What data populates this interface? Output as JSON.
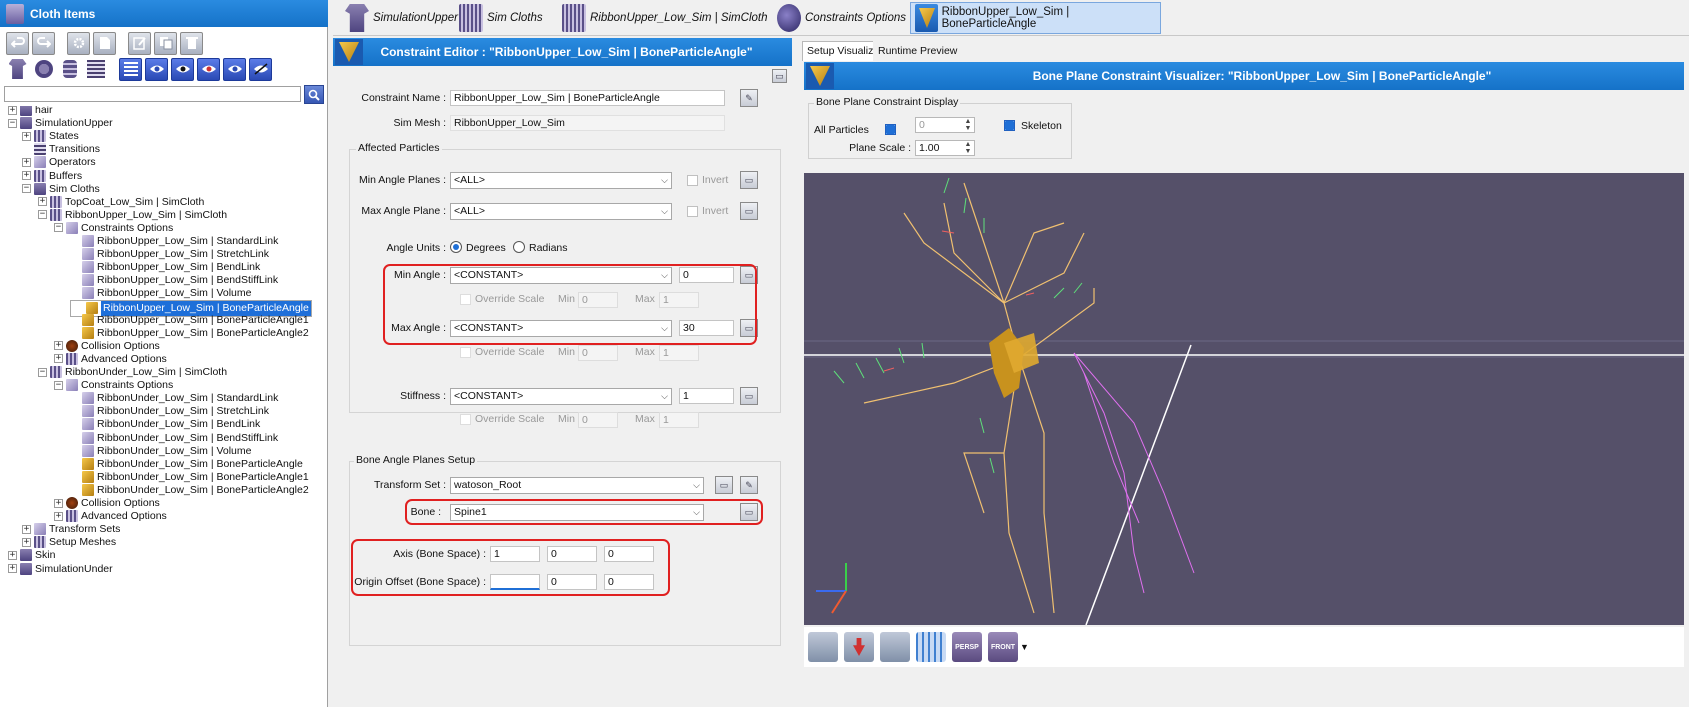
{
  "left_panel": {
    "title": "Cloth Items",
    "search": {
      "value": "",
      "placeholder": ""
    }
  },
  "tree": [
    {
      "label": "hair",
      "depth": 0,
      "exp": "+",
      "icon": "shirt"
    },
    {
      "label": "SimulationUpper",
      "depth": 0,
      "exp": "−",
      "icon": "shirt"
    },
    {
      "label": "States",
      "depth": 1,
      "exp": "+",
      "icon": "grid"
    },
    {
      "label": "Transitions",
      "depth": 1,
      "exp": "",
      "icon": "list"
    },
    {
      "label": "Operators",
      "depth": 1,
      "exp": "+",
      "icon": "link"
    },
    {
      "label": "Buffers",
      "depth": 1,
      "exp": "+",
      "icon": "grid"
    },
    {
      "label": "Sim Cloths",
      "depth": 1,
      "exp": "−",
      "icon": "shirt"
    },
    {
      "label": "TopCoat_Low_Sim | SimCloth",
      "depth": 2,
      "exp": "+",
      "icon": "grid"
    },
    {
      "label": "RibbonUpper_Low_Sim | SimCloth",
      "depth": 2,
      "exp": "−",
      "icon": "grid"
    },
    {
      "label": "Constraints Options",
      "depth": 3,
      "exp": "−",
      "icon": "link"
    },
    {
      "label": "RibbonUpper_Low_Sim | StandardLink",
      "depth": 4,
      "exp": "",
      "icon": "link"
    },
    {
      "label": "RibbonUpper_Low_Sim | StretchLink",
      "depth": 4,
      "exp": "",
      "icon": "link"
    },
    {
      "label": "RibbonUpper_Low_Sim | BendLink",
      "depth": 4,
      "exp": "",
      "icon": "link"
    },
    {
      "label": "RibbonUpper_Low_Sim | BendStiffLink",
      "depth": 4,
      "exp": "",
      "icon": "link"
    },
    {
      "label": "RibbonUpper_Low_Sim | Volume",
      "depth": 4,
      "exp": "",
      "icon": "link"
    },
    {
      "label": "RibbonUpper_Low_Sim | BoneParticleAngle",
      "depth": 4,
      "exp": "",
      "icon": "gold",
      "selected": true
    },
    {
      "label": "RibbonUpper_Low_Sim | BoneParticleAngle1",
      "depth": 4,
      "exp": "",
      "icon": "gold"
    },
    {
      "label": "RibbonUpper_Low_Sim | BoneParticleAngle2",
      "depth": 4,
      "exp": "",
      "icon": "gold"
    },
    {
      "label": "Collision Options",
      "depth": 3,
      "exp": "+",
      "icon": "brown"
    },
    {
      "label": "Advanced Options",
      "depth": 3,
      "exp": "+",
      "icon": "grid"
    },
    {
      "label": "RibbonUnder_Low_Sim | SimCloth",
      "depth": 2,
      "exp": "−",
      "icon": "grid"
    },
    {
      "label": "Constraints Options",
      "depth": 3,
      "exp": "−",
      "icon": "link"
    },
    {
      "label": "RibbonUnder_Low_Sim | StandardLink",
      "depth": 4,
      "exp": "",
      "icon": "link"
    },
    {
      "label": "RibbonUnder_Low_Sim | StretchLink",
      "depth": 4,
      "exp": "",
      "icon": "link"
    },
    {
      "label": "RibbonUnder_Low_Sim | BendLink",
      "depth": 4,
      "exp": "",
      "icon": "link"
    },
    {
      "label": "RibbonUnder_Low_Sim | BendStiffLink",
      "depth": 4,
      "exp": "",
      "icon": "link"
    },
    {
      "label": "RibbonUnder_Low_Sim | Volume",
      "depth": 4,
      "exp": "",
      "icon": "link"
    },
    {
      "label": "RibbonUnder_Low_Sim | BoneParticleAngle",
      "depth": 4,
      "exp": "",
      "icon": "gold"
    },
    {
      "label": "RibbonUnder_Low_Sim | BoneParticleAngle1",
      "depth": 4,
      "exp": "",
      "icon": "gold"
    },
    {
      "label": "RibbonUnder_Low_Sim | BoneParticleAngle2",
      "depth": 4,
      "exp": "",
      "icon": "gold"
    },
    {
      "label": "Collision Options",
      "depth": 3,
      "exp": "+",
      "icon": "brown"
    },
    {
      "label": "Advanced Options",
      "depth": 3,
      "exp": "+",
      "icon": "grid"
    },
    {
      "label": "Transform Sets",
      "depth": 1,
      "exp": "+",
      "icon": "link"
    },
    {
      "label": "Setup Meshes",
      "depth": 1,
      "exp": "+",
      "icon": "grid"
    },
    {
      "label": "Skin",
      "depth": 0,
      "exp": "+",
      "icon": "shirt"
    },
    {
      "label": "SimulationUnder",
      "depth": 0,
      "exp": "+",
      "icon": "shirt"
    }
  ],
  "tabs": [
    {
      "label": "SimulationUpper"
    },
    {
      "label": "Sim Cloths"
    },
    {
      "label": "RibbonUpper_Low_Sim | SimCloth"
    },
    {
      "label": "Constraints Options"
    },
    {
      "label": "RibbonUpper_Low_Sim | BoneParticleAngle"
    }
  ],
  "editor": {
    "title": "Constraint Editor : \"RibbonUpper_Low_Sim | BoneParticleAngle\"",
    "constraint_name_label": "Constraint Name :",
    "constraint_name": "RibbonUpper_Low_Sim | BoneParticleAngle",
    "sim_mesh_label": "Sim Mesh :",
    "sim_mesh": "RibbonUpper_Low_Sim",
    "affected_group": "Affected Particles",
    "min_planes_label": "Min Angle Planes :",
    "min_planes": "<ALL>",
    "max_plane_label": "Max Angle Plane :",
    "max_plane": "<ALL>",
    "invert_label": "Invert",
    "angle_units_label": "Angle Units :",
    "degrees_label": "Degrees",
    "radians_label": "Radians",
    "min_angle_label": "Min Angle :",
    "min_angle_mode": "<CONSTANT>",
    "min_angle_value": "0",
    "max_angle_label": "Max Angle :",
    "max_angle_mode": "<CONSTANT>",
    "max_angle_value": "30",
    "override_scale_label": "Override Scale",
    "min_label": "Min",
    "max_label": "Max",
    "scale_min": "0",
    "scale_max": "1",
    "stiffness_label": "Stiffness :",
    "stiffness_mode": "<CONSTANT>",
    "stiffness_value": "1",
    "bone_group": "Bone Angle Planes Setup",
    "transform_set_label": "Transform Set :",
    "transform_set": "watoson_Root",
    "bone_label": "Bone :",
    "bone": "Spine1",
    "axis_label": "Axis (Bone Space) :",
    "axis": [
      "1",
      "0",
      "0"
    ],
    "origin_label": "Origin Offset (Bone Space) :",
    "origin": [
      "",
      "0",
      "0"
    ]
  },
  "visualizer": {
    "tab_setup": "Setup Visualizer",
    "tab_runtime": "Runtime Preview",
    "title": "Bone Plane Constraint Visualizer: \"RibbonUpper_Low_Sim | BoneParticleAngle\"",
    "display_group": "Bone Plane Constraint Display",
    "all_particles_label": "All Particles",
    "all_particles_value": "0",
    "skeleton_label": "Skeleton",
    "plane_scale_label": "Plane Scale :",
    "plane_scale": "1.00",
    "persp_label": "PERSP",
    "front_label": "FRONT"
  },
  "colors": {
    "title_blue": "#1a7dd6",
    "viewport_bg": "#555069",
    "highlight_red": "#e02020",
    "selection": "#1e6fd9"
  }
}
